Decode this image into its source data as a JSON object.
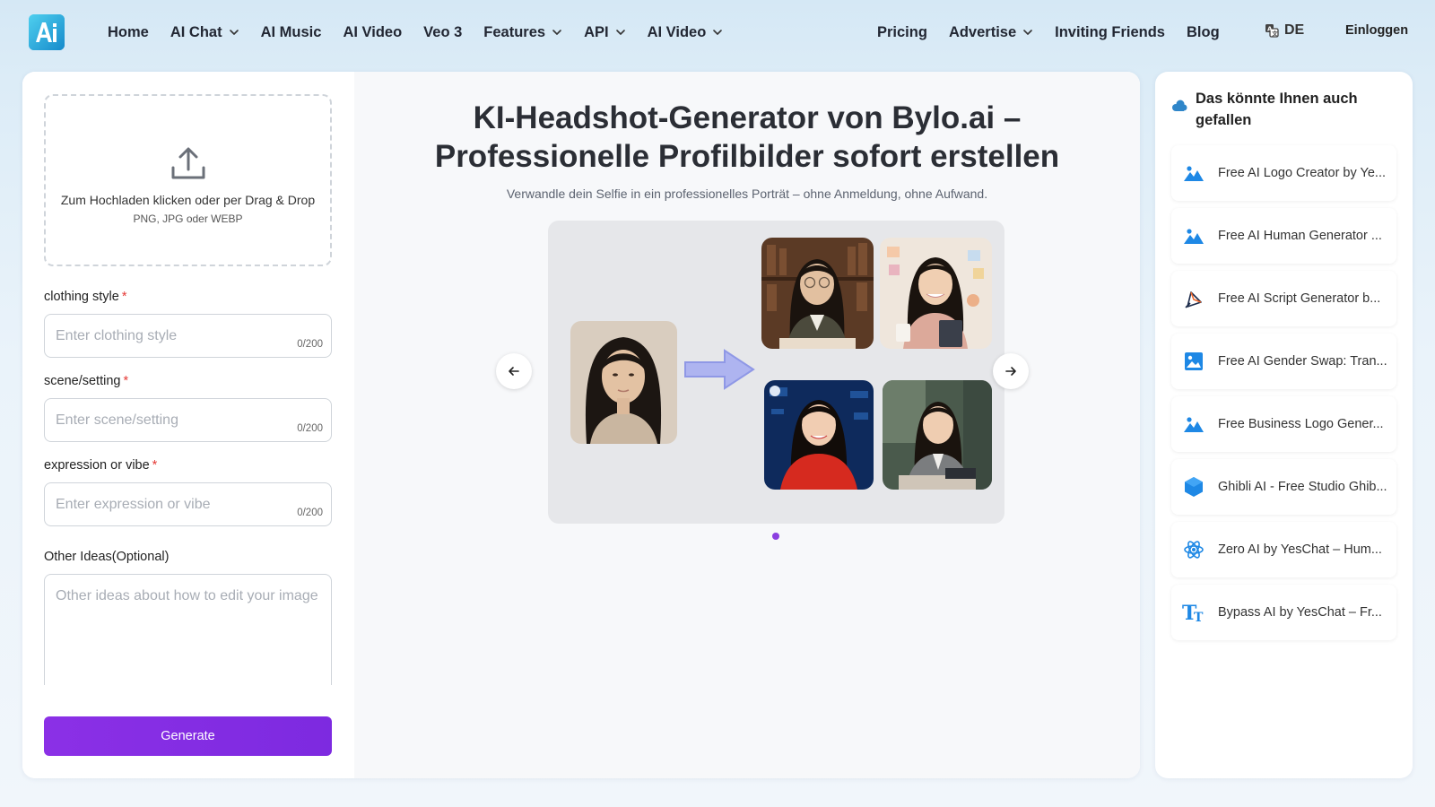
{
  "header": {
    "nav_left": [
      {
        "label": "Home",
        "has_dropdown": false
      },
      {
        "label": "AI Chat",
        "has_dropdown": true
      },
      {
        "label": "AI Music",
        "has_dropdown": false
      },
      {
        "label": "AI Video",
        "has_dropdown": false
      },
      {
        "label": "Veo 3",
        "has_dropdown": false
      },
      {
        "label": "Features",
        "has_dropdown": true
      },
      {
        "label": "API",
        "has_dropdown": true
      },
      {
        "label": "AI Video",
        "has_dropdown": true
      }
    ],
    "nav_right": [
      {
        "label": "Pricing",
        "has_dropdown": false
      },
      {
        "label": "Advertise",
        "has_dropdown": true
      },
      {
        "label": "Inviting Friends",
        "has_dropdown": false
      },
      {
        "label": "Blog",
        "has_dropdown": false
      }
    ],
    "language": "DE",
    "login": "Einloggen"
  },
  "form": {
    "upload_title": "Zum Hochladen klicken oder per Drag & Drop",
    "upload_formats": "PNG, JPG oder WEBP",
    "fields": [
      {
        "label": "clothing style",
        "required": "*",
        "placeholder": "Enter clothing style",
        "counter": "0/200"
      },
      {
        "label": "scene/setting",
        "required": "*",
        "placeholder": "Enter scene/setting",
        "counter": "0/200"
      },
      {
        "label": "expression or vibe",
        "required": "*",
        "placeholder": "Enter expression or vibe",
        "counter": "0/200"
      }
    ],
    "other_label": "Other Ideas(Optional)",
    "other_placeholder": "Other ideas about how to edit your image",
    "generate_label": "Generate",
    "accent_color": "#8b30e6"
  },
  "hero": {
    "title_line1": "KI-Headshot-Generator von Bylo.ai –",
    "title_line2": "Professionelle Profilbilder sofort erstellen",
    "subtitle": "Verwandle dein Selfie in ein professionelles Porträt – ohne Anmeldung, ohne Aufwand.",
    "carousel_current_slide": 1,
    "carousel_total_slides": 1
  },
  "sidebar": {
    "title": "Das könnte Ihnen auch gefallen",
    "items": [
      {
        "label": "Free AI Logo Creator by Ye...",
        "icon": "mountain-image-icon"
      },
      {
        "label": "Free AI Human Generator ...",
        "icon": "mountain-image-icon"
      },
      {
        "label": "Free AI Script Generator b...",
        "icon": "script-quill-icon"
      },
      {
        "label": "Free AI Gender Swap: Tran...",
        "icon": "picture-frame-icon"
      },
      {
        "label": "Free Business Logo Gener...",
        "icon": "mountain-image-icon"
      },
      {
        "label": "Ghibli AI - Free Studio Ghib...",
        "icon": "hexagon-icon"
      },
      {
        "label": "Zero AI by YesChat – Hum...",
        "icon": "atom-icon"
      },
      {
        "label": "Bypass AI by YesChat – Fr...",
        "icon": "text-tt-icon"
      }
    ]
  }
}
